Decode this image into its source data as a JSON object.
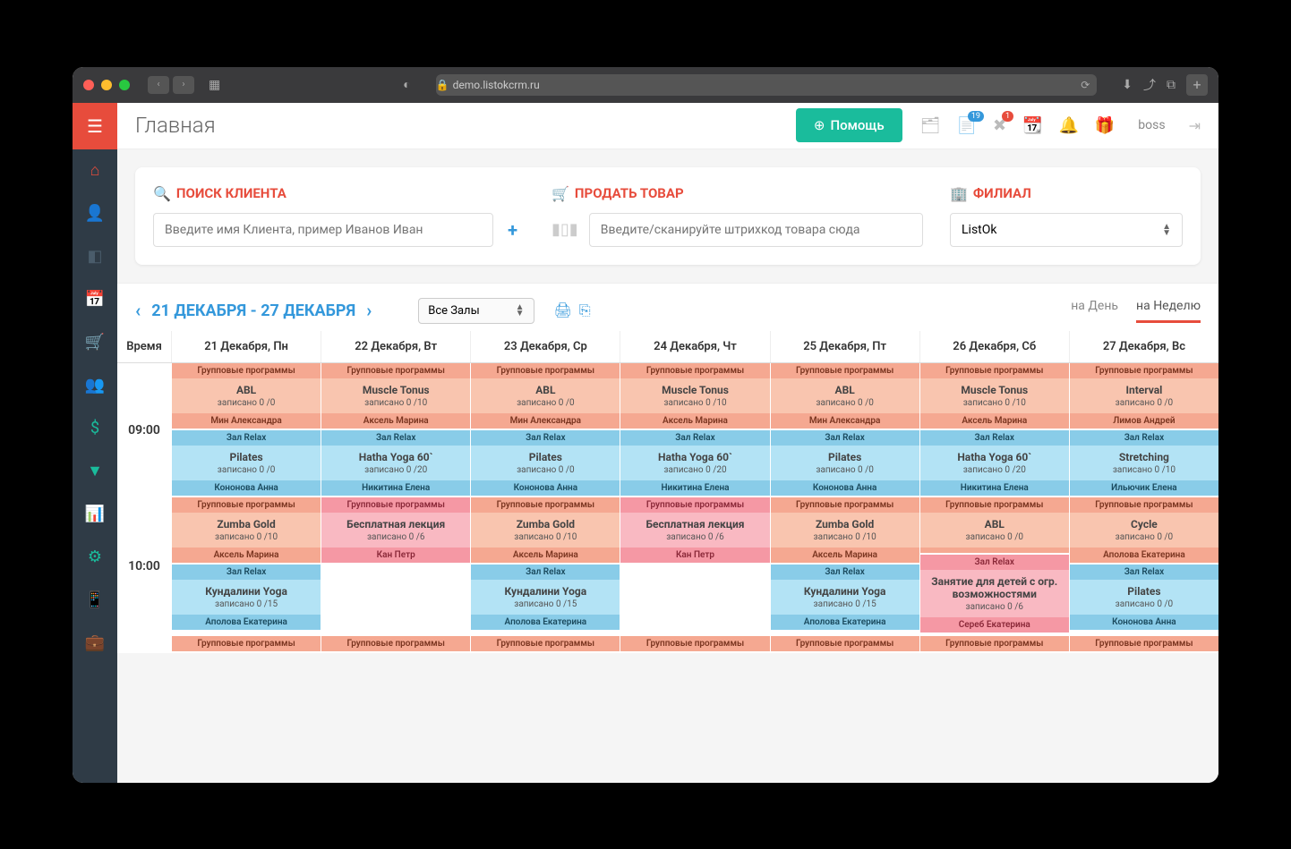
{
  "browser": {
    "url": "demo.listokcrm.ru"
  },
  "header": {
    "title": "Главная",
    "help_label": "Помощь",
    "badge1": "19",
    "badge2": "1",
    "user": "boss"
  },
  "panels": {
    "search": {
      "title": "ПОИСК КЛИЕНТА",
      "placeholder": "Введите имя Клиента, пример Иванов Иван"
    },
    "sell": {
      "title": "ПРОДАТЬ ТОВАР",
      "placeholder": "Введите/сканируйте штрихкод товара сюда"
    },
    "branch": {
      "title": "ФИЛИАЛ",
      "value": "ListOk"
    }
  },
  "calendar": {
    "range": "21 ДЕКАБРЯ - 27 ДЕКАБРЯ",
    "hall_select": "Все Залы",
    "view_day": "на День",
    "view_week": "на Неделю",
    "time_header": "Время",
    "days": [
      "21 Декабря, Пн",
      "22 Декабря, Вт",
      "23 Декабря, Ср",
      "24 Декабря, Чт",
      "25 Декабря, Пт",
      "26 Декабря, Сб",
      "27 Декабря, Вс"
    ],
    "times": [
      "09:00",
      "10:00"
    ],
    "labels": {
      "group": "Групповые программы",
      "relax": "Зал Relax"
    },
    "rows": [
      {
        "time": "09:00",
        "band1": [
          {
            "c": "orange",
            "n": "ABL",
            "cap": "записано 0 /0",
            "t": "Мин Александра"
          },
          {
            "c": "orange",
            "n": "Muscle Tonus",
            "cap": "записано 0 /10",
            "t": "Аксель Марина"
          },
          {
            "c": "orange",
            "n": "ABL",
            "cap": "записано 0 /0",
            "t": "Мин Александра"
          },
          {
            "c": "orange",
            "n": "Muscle Tonus",
            "cap": "записано 0 /10",
            "t": "Аксель Марина"
          },
          {
            "c": "orange",
            "n": "ABL",
            "cap": "записано 0 /0",
            "t": "Мин Александра"
          },
          {
            "c": "orange",
            "n": "Muscle Tonus",
            "cap": "записано 0 /10",
            "t": "Аксель Марина"
          },
          {
            "c": "orange",
            "n": "Interval",
            "cap": "записано 0 /0",
            "t": "Лимов Андрей"
          }
        ],
        "band2": [
          {
            "c": "blue",
            "n": "Pilates",
            "cap": "записано 0 /0",
            "t": "Кононова Анна"
          },
          {
            "c": "blue",
            "n": "Hatha Yoga 60`",
            "cap": "записано 0 /20",
            "t": "Никитина Елена"
          },
          {
            "c": "blue",
            "n": "Pilates",
            "cap": "записано 0 /0",
            "t": "Кононова Анна"
          },
          {
            "c": "blue",
            "n": "Hatha Yoga 60`",
            "cap": "записано 0 /20",
            "t": "Никитина Елена"
          },
          {
            "c": "blue",
            "n": "Pilates",
            "cap": "записано 0 /0",
            "t": "Кононова Анна"
          },
          {
            "c": "blue",
            "n": "Hatha Yoga 60`",
            "cap": "записано 0 /20",
            "t": "Никитина Елена"
          },
          {
            "c": "blue",
            "n": "Stretching",
            "cap": "записано 0 /10",
            "t": "Ильючик Елена"
          }
        ]
      },
      {
        "time": "10:00",
        "band1": [
          {
            "c": "orange",
            "n": "Zumba Gold",
            "cap": "записано 0 /10",
            "t": "Аксель Марина"
          },
          {
            "c": "pink",
            "n": "Бесплатная лекция",
            "cap": "записано 0 /6",
            "t": "Кан Петр"
          },
          {
            "c": "orange",
            "n": "Zumba Gold",
            "cap": "записано 0 /10",
            "t": "Аксель Марина"
          },
          {
            "c": "pink",
            "n": "Бесплатная лекция",
            "cap": "записано 0 /6",
            "t": "Кан Петр"
          },
          {
            "c": "orange",
            "n": "Zumba Gold",
            "cap": "записано 0 /10",
            "t": "Аксель Марина"
          },
          {
            "c": "orange",
            "n": "ABL",
            "cap": "записано 0 /0",
            "t": ""
          },
          {
            "c": "orange",
            "n": "Cycle",
            "cap": "записано 0 /0",
            "t": "Аполова Екатерина"
          }
        ],
        "band2": [
          {
            "c": "blue",
            "n": "Кундалини Yoga",
            "cap": "записано 0 /15",
            "t": "Аполова Екатерина"
          },
          {
            "c": "empty"
          },
          {
            "c": "blue",
            "n": "Кундалини Yoga",
            "cap": "записано 0 /15",
            "t": "Аполова Екатерина"
          },
          {
            "c": "empty"
          },
          {
            "c": "blue",
            "n": "Кундалини Yoga",
            "cap": "записано 0 /15",
            "t": "Аполова Екатерина"
          },
          {
            "c": "pink",
            "n": "Занятие для детей с огр. возможностями",
            "cap": "записано 0 /6",
            "t": "Сереб Екатерина"
          },
          {
            "c": "blue",
            "n": "Pilates",
            "cap": "записано 0 /0",
            "t": "Кононова Анна"
          }
        ]
      }
    ],
    "bottom_row_label": "Групповые программы"
  }
}
